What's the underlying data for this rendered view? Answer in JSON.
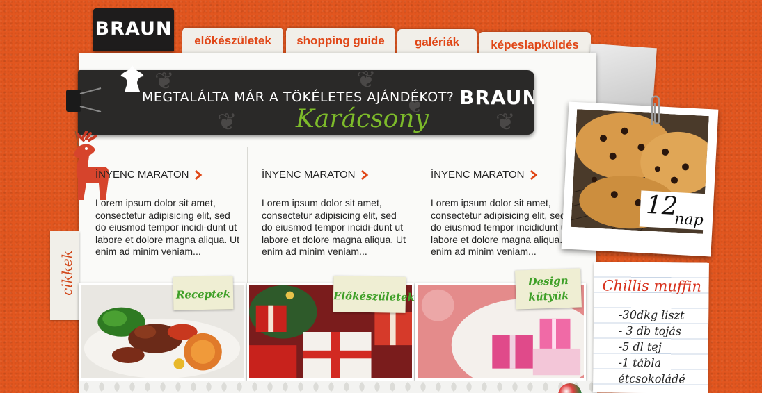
{
  "brand": {
    "logo": "BRAUN"
  },
  "nav": {
    "tabs": [
      {
        "label": "előkészületek"
      },
      {
        "label": "shopping guide"
      },
      {
        "label": "galériák"
      },
      {
        "label": "képeslapküldés"
      }
    ]
  },
  "banner": {
    "headline": "MEGTALÁLTA MÁR A TÖKÉLETES AJÁNDÉKOT?",
    "script": "Karácsony",
    "logo": "BRAUN"
  },
  "sidebar": {
    "label": "cikkek"
  },
  "articles": [
    {
      "heading": "ÍNYENC MARATON",
      "body": "Lorem ipsum dolor sit amet, consectetur adipisicing elit, sed do eiusmod tempor incidi-dunt ut labore et dolore magna aliqua. Ut enim ad minim veniam..."
    },
    {
      "heading": "ÍNYENC MARATON",
      "body": "Lorem ipsum dolor sit amet, consectetur adipisicing elit, sed do eiusmod tempor incidi-dunt ut labore et dolore magna aliqua. Ut enim ad minim veniam..."
    },
    {
      "heading": "ÍNYENC MARATON",
      "body": "Lorem ipsum dolor sit amet, consectetur adipisicing elit, sed do eiusmod tempor incididunt ut labore et dolore magna aliqua. Ut enim ad minim veniam..."
    }
  ],
  "tiles": [
    {
      "label": "Receptek"
    },
    {
      "label": "Előkészületek"
    },
    {
      "label_line1": "Design",
      "label_line2": "kütyük"
    }
  ],
  "countdown": {
    "number": "12",
    "unit": "nap"
  },
  "recipe_note": {
    "title": "Chillis muffin",
    "items": [
      "-30dkg liszt",
      "- 3 db tojás",
      "-5 dl tej",
      "-1 tábla",
      "étcsokoládé"
    ]
  },
  "colors": {
    "background": "#e2561f",
    "accent": "#e04717",
    "green": "#3fa028"
  }
}
